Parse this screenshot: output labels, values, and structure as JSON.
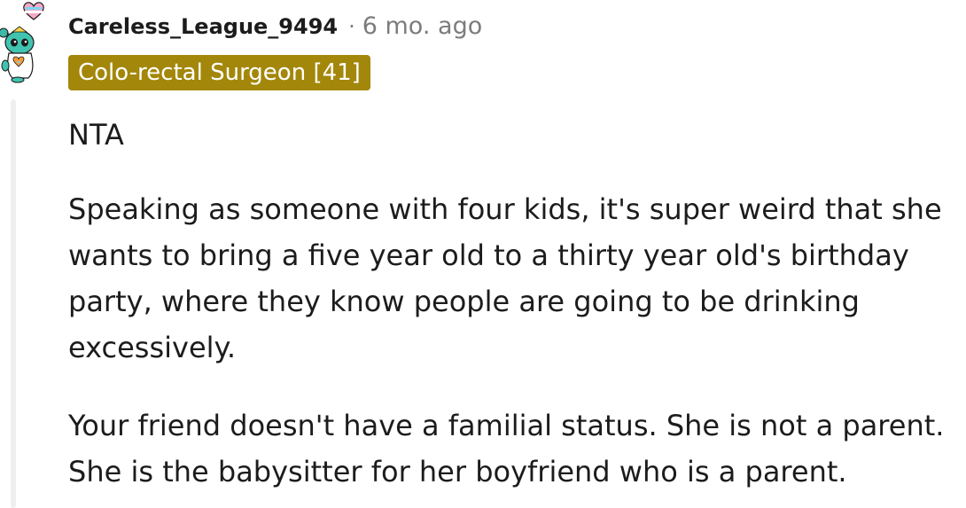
{
  "comment": {
    "username": "Careless_League_9494",
    "separator": "·",
    "timestamp": "6 mo. ago",
    "flair": "Colo-rectal Surgeon [41]",
    "avatar_icon": "snoo-avatar-icon",
    "flair_color": "#a3870a",
    "paragraphs": [
      [
        "NTA"
      ],
      [
        "Speaking as someone with four kids, it's super weird that she",
        "wants to bring a five year old to a thirty year old's birthday",
        "party, where they know people are going to be drinking",
        "excessively."
      ],
      [
        "Your friend doesn't have a familial status. She is not a parent.",
        "She is the babysitter for her boyfriend who is a parent."
      ]
    ]
  }
}
